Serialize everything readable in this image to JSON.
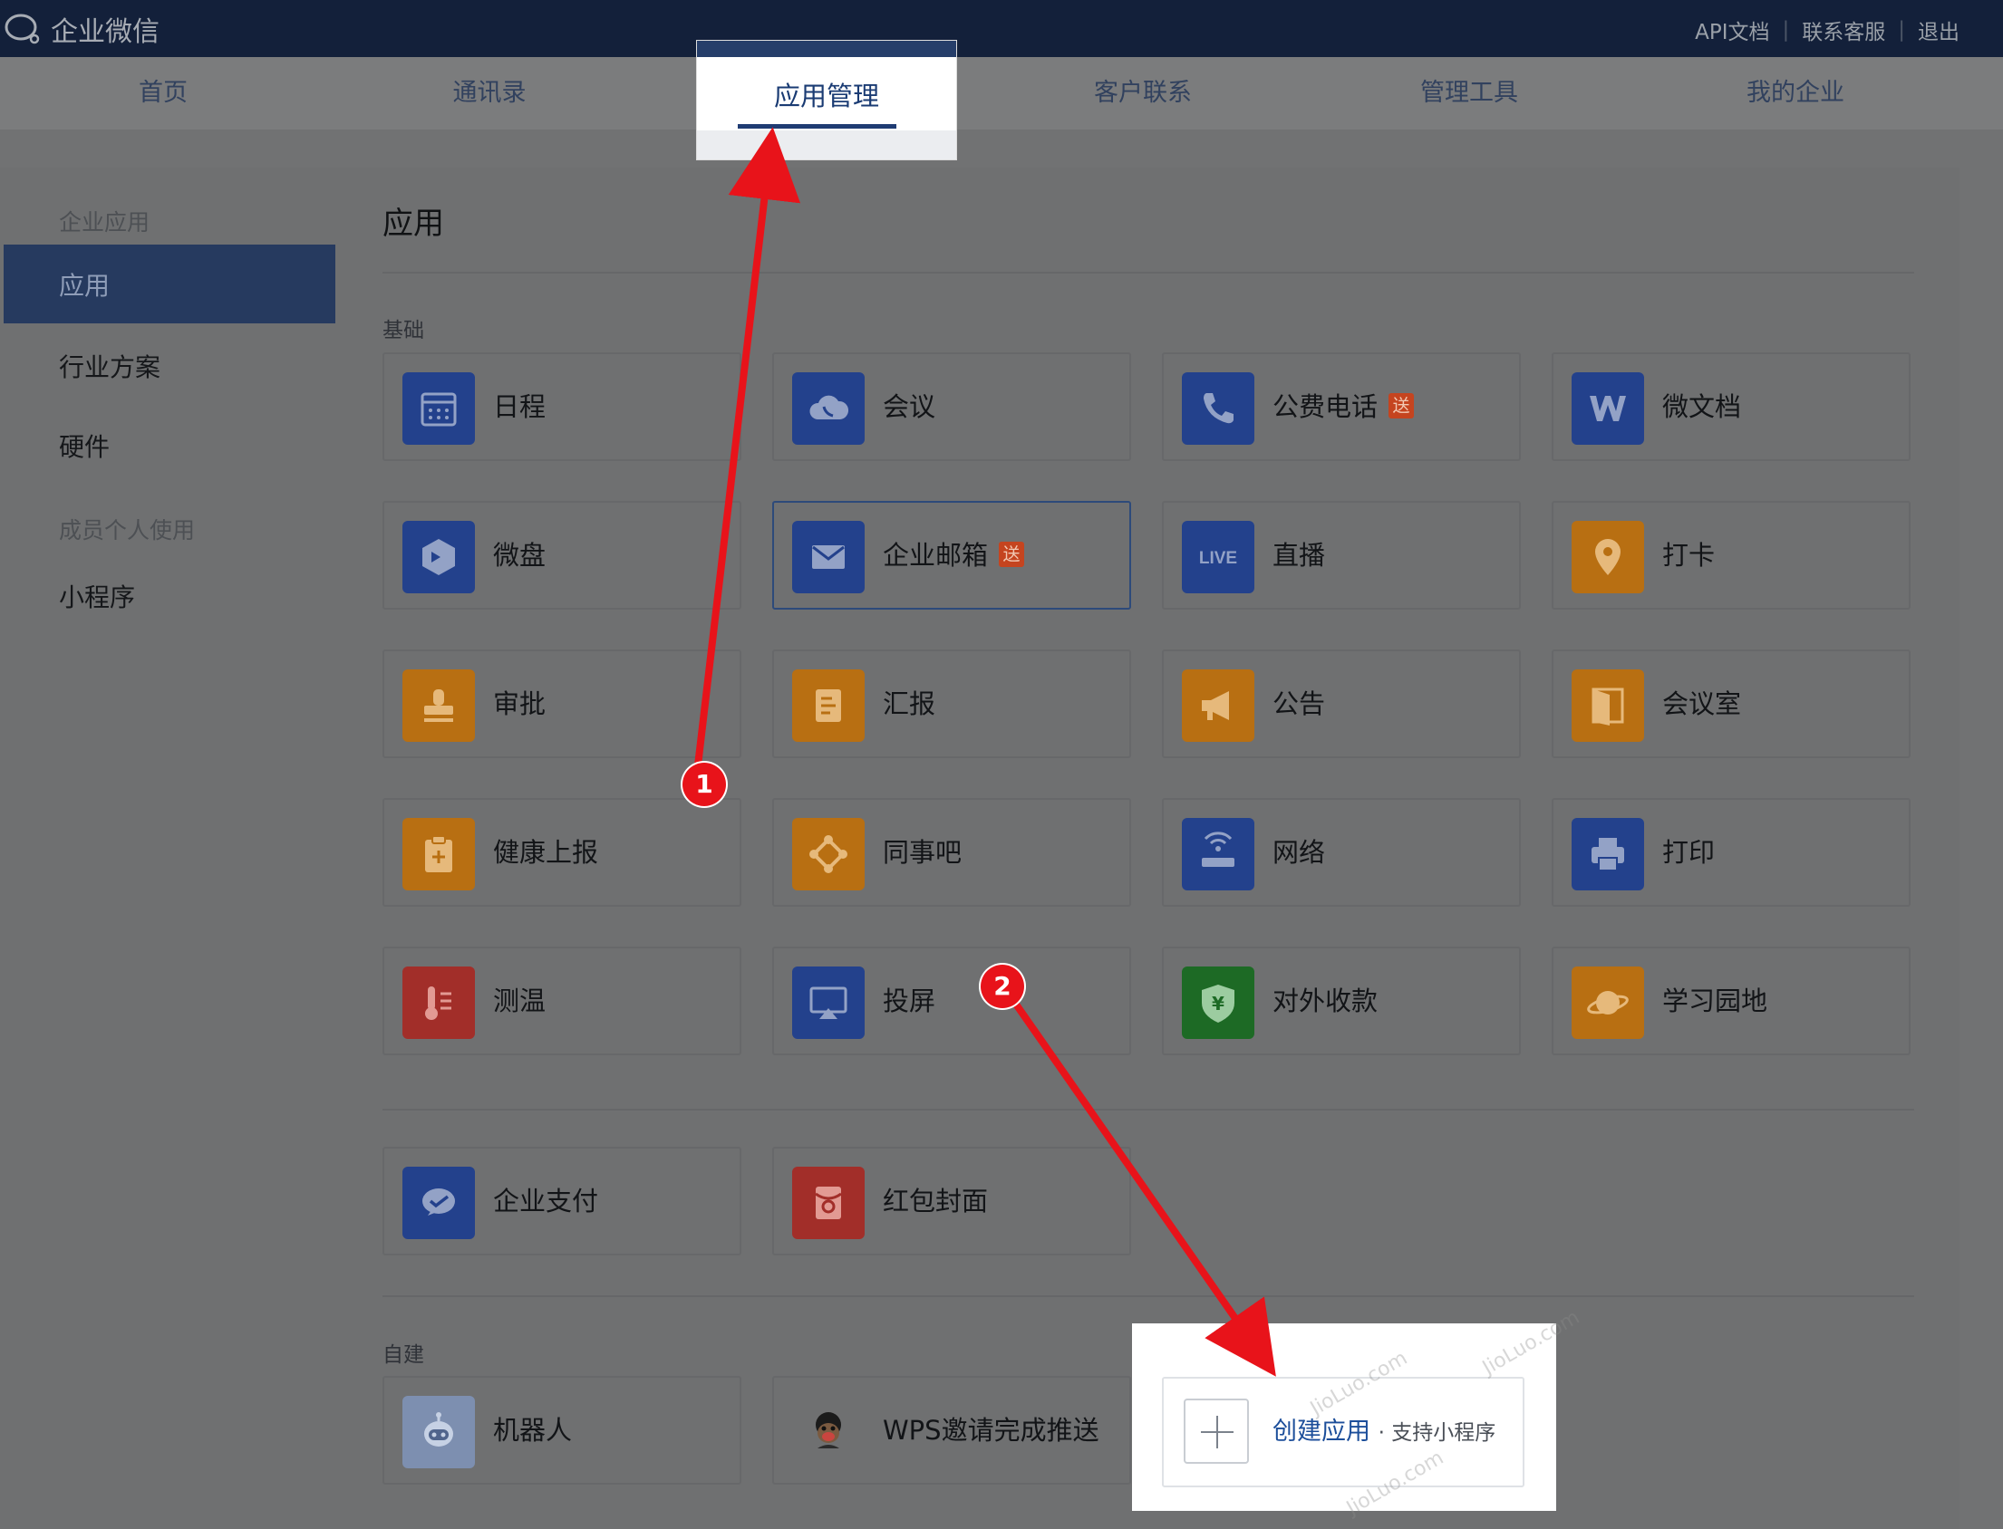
{
  "topbar": {
    "brand": "企业微信",
    "links": [
      "API文档",
      "联系客服",
      "退出"
    ]
  },
  "nav": {
    "items": [
      "首页",
      "通讯录",
      "应用管理",
      "客户联系",
      "管理工具",
      "我的企业"
    ],
    "active": "应用管理"
  },
  "sidebar": {
    "group1": "企业应用",
    "active_item": "应用",
    "items": [
      "行业方案",
      "硬件"
    ],
    "group2": "成员个人使用",
    "items2": [
      "小程序"
    ]
  },
  "main": {
    "title": "应用",
    "section_basic": "基础",
    "section_custom": "自建",
    "basic_apps": [
      {
        "label": "日程",
        "icon": "calendar-icon",
        "color": "#23418c"
      },
      {
        "label": "会议",
        "icon": "cloud-phone-icon",
        "color": "#23418c"
      },
      {
        "label": "公费电话",
        "icon": "phone-icon",
        "color": "#23418c",
        "badge": "送"
      },
      {
        "label": "微文档",
        "icon": "w-doc-icon",
        "color": "#23418c"
      },
      {
        "label": "微盘",
        "icon": "cube-icon",
        "color": "#23418c"
      },
      {
        "label": "企业邮箱",
        "icon": "mail-icon",
        "color": "#23418c",
        "badge": "送"
      },
      {
        "label": "直播",
        "icon": "live-icon",
        "color": "#23418c"
      },
      {
        "label": "打卡",
        "icon": "location-pin-icon",
        "color": "#b86f12"
      },
      {
        "label": "审批",
        "icon": "stamp-icon",
        "color": "#b86f12"
      },
      {
        "label": "汇报",
        "icon": "report-icon",
        "color": "#b86f12"
      },
      {
        "label": "公告",
        "icon": "megaphone-icon",
        "color": "#b86f12"
      },
      {
        "label": "会议室",
        "icon": "door-icon",
        "color": "#b86f12"
      },
      {
        "label": "健康上报",
        "icon": "clipboard-plus-icon",
        "color": "#b86f12"
      },
      {
        "label": "同事吧",
        "icon": "network-nodes-icon",
        "color": "#b86f12"
      },
      {
        "label": "网络",
        "icon": "router-icon",
        "color": "#23418c"
      },
      {
        "label": "打印",
        "icon": "printer-icon",
        "color": "#23418c"
      },
      {
        "label": "测温",
        "icon": "thermometer-icon",
        "color": "#a22e29"
      },
      {
        "label": "投屏",
        "icon": "airplay-icon",
        "color": "#23418c"
      },
      {
        "label": "对外收款",
        "icon": "yuan-shield-icon",
        "color": "#1d6a25"
      },
      {
        "label": "学习园地",
        "icon": "planet-icon",
        "color": "#b86f12"
      }
    ],
    "extra_apps": [
      {
        "label": "企业支付",
        "icon": "wechat-pay-icon",
        "color": "#23418c"
      },
      {
        "label": "红包封面",
        "icon": "red-packet-icon",
        "color": "#a22e29"
      }
    ],
    "custom_apps": [
      {
        "label": "机器人",
        "icon": "robot-icon",
        "color": "#7d8fb0"
      },
      {
        "label": "WPS邀请完成推送",
        "icon": "monkey-avatar-icon",
        "color": "#6f7071"
      }
    ],
    "create": {
      "label": "创建应用",
      "sub": "· 支持小程序"
    }
  },
  "annotations": {
    "step1": "1",
    "step2": "2",
    "watermark": "JioLuo.com"
  }
}
